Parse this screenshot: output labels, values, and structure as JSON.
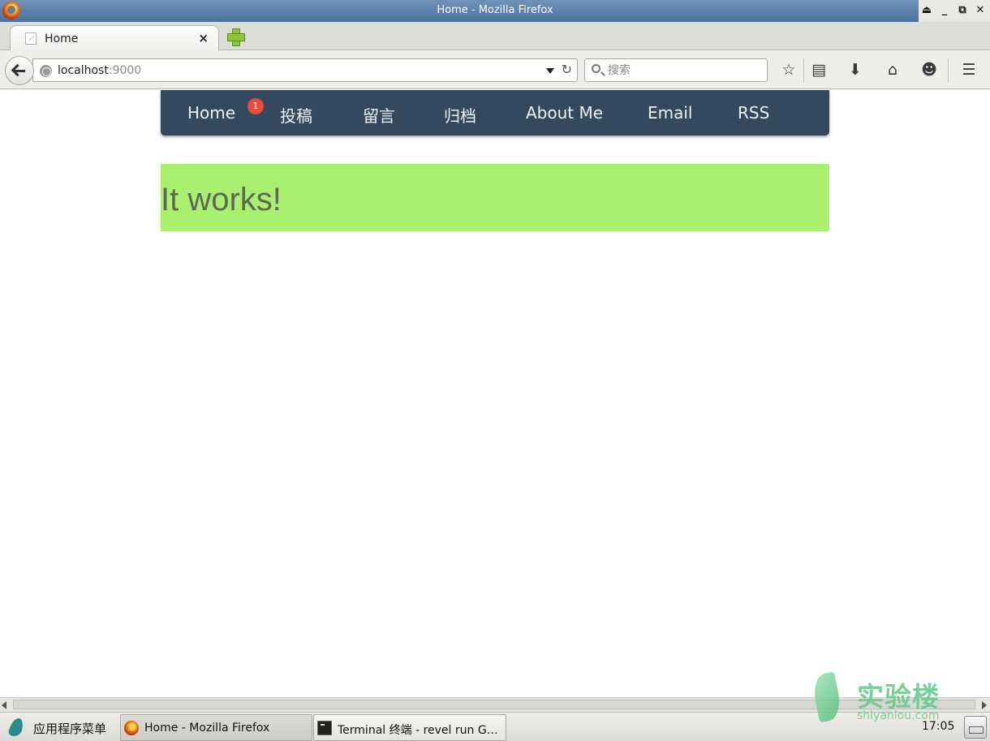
{
  "window": {
    "title": "Home - Mozilla Firefox"
  },
  "tab": {
    "label": "Home",
    "close": "×"
  },
  "address": {
    "host": "localhost",
    "port": ":9000",
    "reload": "C"
  },
  "search": {
    "placeholder": "搜索"
  },
  "site_nav": {
    "items": [
      {
        "label": "Home"
      },
      {
        "label": "投稿"
      },
      {
        "label": "留言"
      },
      {
        "label": "归档"
      },
      {
        "label": "About Me"
      },
      {
        "label": "Email"
      },
      {
        "label": "RSS"
      }
    ],
    "badge": "1"
  },
  "hero": {
    "text": "It works!"
  },
  "watermark": {
    "cn": "实验楼",
    "en": "shiyanlou.com"
  },
  "taskbar": {
    "menu_label": "应用程序菜单",
    "tasks": [
      {
        "label": "Home - Mozilla Firefox"
      },
      {
        "label": "Terminal 终端 - revel run G…"
      }
    ],
    "clock": "17:05"
  },
  "colors": {
    "nav_bg": "#34495e",
    "hero_bg": "#a9f06e",
    "badge_bg": "#e74c3c"
  }
}
